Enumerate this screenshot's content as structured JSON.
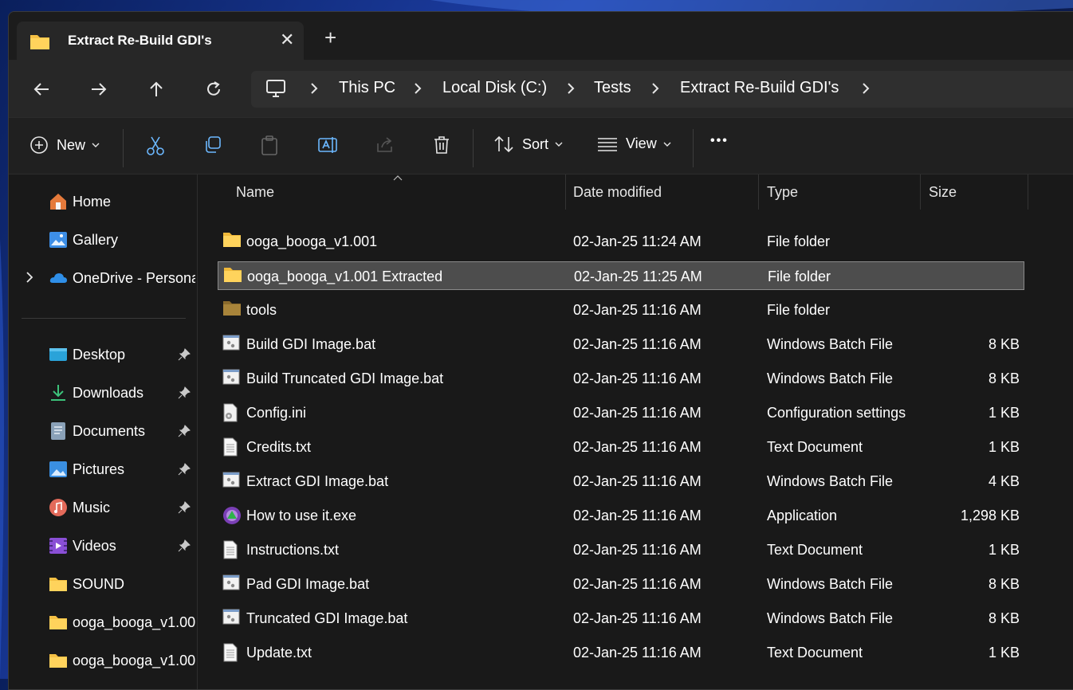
{
  "window": {
    "tab_title": "Extract Re-Build GDI's",
    "close_glyph": "✕",
    "new_tab_glyph": "+"
  },
  "address": {
    "segments": [
      "This PC",
      "Local Disk (C:)",
      "Tests",
      "Extract Re-Build GDI's"
    ]
  },
  "toolbar": {
    "new_label": "New",
    "sort_label": "Sort",
    "view_label": "View",
    "more_glyph": "•••"
  },
  "columns": {
    "name": "Name",
    "date": "Date modified",
    "type": "Type",
    "size": "Size"
  },
  "sidebar": {
    "items": [
      {
        "label": "Home",
        "icon": "home-icon",
        "pinned": false
      },
      {
        "label": "Gallery",
        "icon": "gallery-icon",
        "pinned": false
      },
      {
        "label": "OneDrive - Persona",
        "icon": "onedrive-icon",
        "pinned": false
      },
      {
        "label": "Desktop",
        "icon": "desktop-icon",
        "pinned": true
      },
      {
        "label": "Downloads",
        "icon": "downloads-icon",
        "pinned": true
      },
      {
        "label": "Documents",
        "icon": "documents-icon",
        "pinned": true
      },
      {
        "label": "Pictures",
        "icon": "pictures-icon",
        "pinned": true
      },
      {
        "label": "Music",
        "icon": "music-icon",
        "pinned": true
      },
      {
        "label": "Videos",
        "icon": "videos-icon",
        "pinned": true
      },
      {
        "label": "SOUND",
        "icon": "folder-icon",
        "pinned": false
      },
      {
        "label": "ooga_booga_v1.00",
        "icon": "folder-icon",
        "pinned": false
      },
      {
        "label": "ooga_booga_v1.00",
        "icon": "folder-icon",
        "pinned": false
      }
    ]
  },
  "files": [
    {
      "name": "ooga_booga_v1.001",
      "date": "02-Jan-25 11:24 AM",
      "type": "File folder",
      "size": "",
      "icon": "folder-icon",
      "selected": false
    },
    {
      "name": "ooga_booga_v1.001 Extracted",
      "date": "02-Jan-25 11:25 AM",
      "type": "File folder",
      "size": "",
      "icon": "folder-icon",
      "selected": true
    },
    {
      "name": "tools",
      "date": "02-Jan-25 11:16 AM",
      "type": "File folder",
      "size": "",
      "icon": "folder-dark-icon",
      "selected": false
    },
    {
      "name": "Build GDI Image.bat",
      "date": "02-Jan-25 11:16 AM",
      "type": "Windows Batch File",
      "size": "8 KB",
      "icon": "batch-file-icon",
      "selected": false
    },
    {
      "name": "Build Truncated GDI Image.bat",
      "date": "02-Jan-25 11:16 AM",
      "type": "Windows Batch File",
      "size": "8 KB",
      "icon": "batch-file-icon",
      "selected": false
    },
    {
      "name": "Config.ini",
      "date": "02-Jan-25 11:16 AM",
      "type": "Configuration settings",
      "size": "1 KB",
      "icon": "config-file-icon",
      "selected": false
    },
    {
      "name": "Credits.txt",
      "date": "02-Jan-25 11:16 AM",
      "type": "Text Document",
      "size": "1 KB",
      "icon": "text-file-icon",
      "selected": false
    },
    {
      "name": "Extract GDI Image.bat",
      "date": "02-Jan-25 11:16 AM",
      "type": "Windows Batch File",
      "size": "4 KB",
      "icon": "batch-file-icon",
      "selected": false
    },
    {
      "name": "How to use it.exe",
      "date": "02-Jan-25 11:16 AM",
      "type": "Application",
      "size": "1,298 KB",
      "icon": "application-icon",
      "selected": false
    },
    {
      "name": "Instructions.txt",
      "date": "02-Jan-25 11:16 AM",
      "type": "Text Document",
      "size": "1 KB",
      "icon": "text-file-icon",
      "selected": false
    },
    {
      "name": "Pad GDI Image.bat",
      "date": "02-Jan-25 11:16 AM",
      "type": "Windows Batch File",
      "size": "8 KB",
      "icon": "batch-file-icon",
      "selected": false
    },
    {
      "name": "Truncated GDI Image.bat",
      "date": "02-Jan-25 11:16 AM",
      "type": "Windows Batch File",
      "size": "8 KB",
      "icon": "batch-file-icon",
      "selected": false
    },
    {
      "name": "Update.txt",
      "date": "02-Jan-25 11:16 AM",
      "type": "Text Document",
      "size": "1 KB",
      "icon": "text-file-icon",
      "selected": false
    }
  ],
  "colors": {
    "window_bg": "#191919",
    "selected_row": "#4d4d4d",
    "folder_yellow": "#f5c044",
    "accent_blue": "#4aa3ff"
  }
}
